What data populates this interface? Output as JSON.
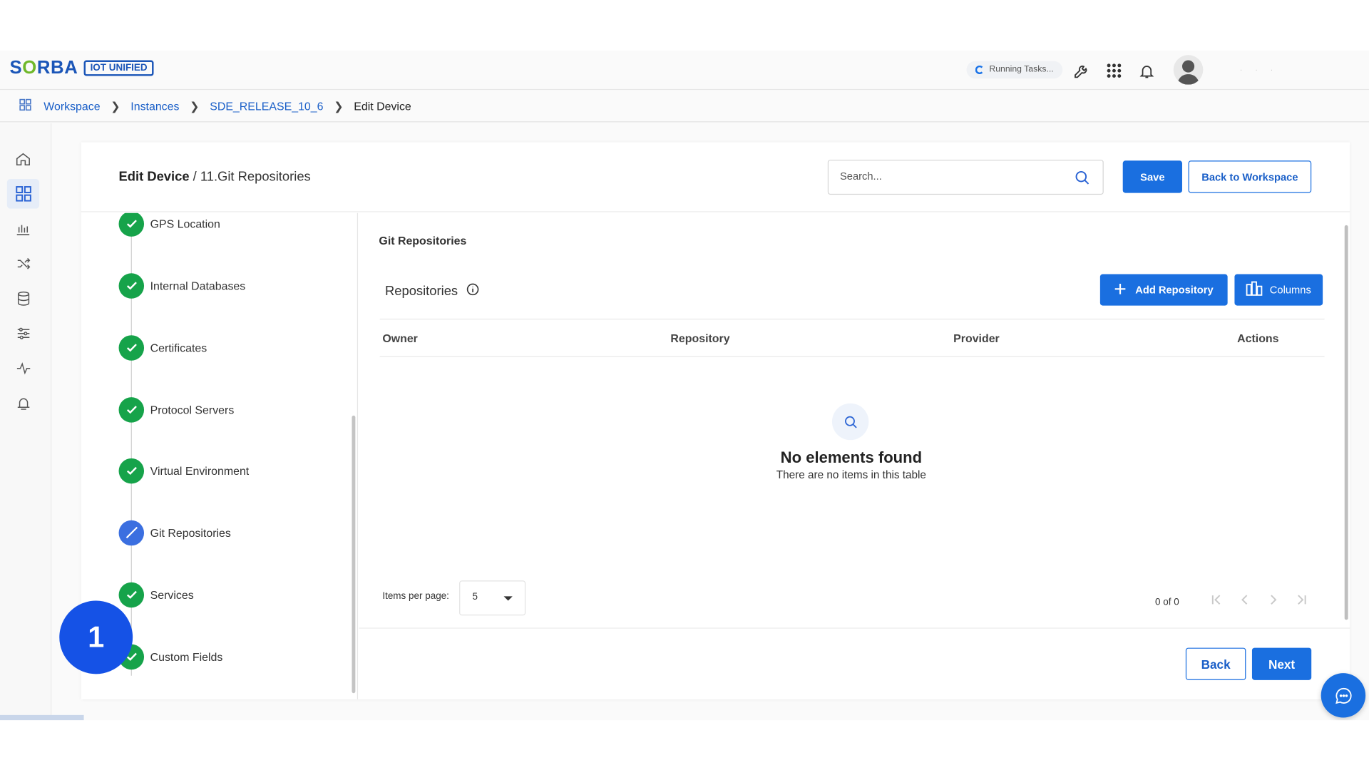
{
  "header": {
    "logo_text_1": "S",
    "logo_text_2": "O",
    "logo_text_3": "RBA",
    "logo_badge": "IOT UNIFIED",
    "running_tasks": "Running Tasks...",
    "icons": [
      "wrench-icon",
      "apps-grid-icon",
      "bell-icon",
      "avatar"
    ]
  },
  "breadcrumb": {
    "items": [
      "Workspace",
      "Instances",
      "SDE_RELEASE_10_6"
    ],
    "current": "Edit Device"
  },
  "rail": {
    "icons": [
      "home-icon",
      "dashboard-icon",
      "chart-icon",
      "shuffle-icon",
      "database-icon",
      "sliders-icon",
      "pulse-icon",
      "alarm-icon"
    ],
    "active": "dashboard-icon"
  },
  "page": {
    "title": "Edit Device",
    "separator": " / ",
    "subtitle": "11.Git Repositories",
    "search_placeholder": "Search...",
    "save_label": "Save",
    "back_to_workspace_label": "Back to Workspace"
  },
  "steps": [
    {
      "label": "GPS Location",
      "state": "done"
    },
    {
      "label": "Internal Databases",
      "state": "done"
    },
    {
      "label": "Certificates",
      "state": "done"
    },
    {
      "label": "Protocol Servers",
      "state": "done"
    },
    {
      "label": "Virtual Environment",
      "state": "done"
    },
    {
      "label": "Git Repositories",
      "state": "current"
    },
    {
      "label": "Services",
      "state": "done"
    },
    {
      "label": "Custom Fields",
      "state": "done"
    }
  ],
  "content": {
    "section_title": "Git Repositories",
    "repositories_title": "Repositories",
    "add_repository_label": "Add Repository",
    "columns_label": "Columns",
    "table_columns": [
      "Owner",
      "Repository",
      "Provider",
      "Actions"
    ],
    "empty_title": "No elements found",
    "empty_subtitle": "There are no items in this table",
    "items_per_page_label": "Items per page:",
    "items_per_page_value": "5",
    "range_label": "0 of 0"
  },
  "footer": {
    "back_label": "Back",
    "next_label": "Next"
  },
  "overlay": {
    "marker_number": "1"
  },
  "colors": {
    "primary": "#1a6fe0",
    "success": "#16a34a",
    "current_step": "#3b6fe0",
    "marker": "#1552e6"
  }
}
